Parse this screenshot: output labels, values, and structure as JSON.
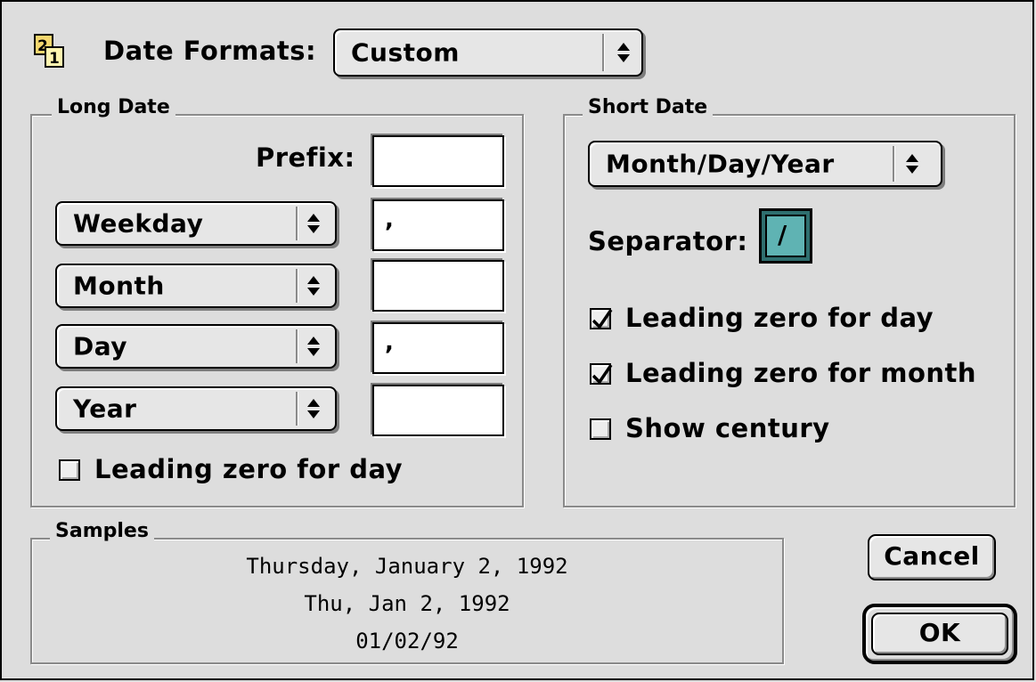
{
  "header": {
    "icon": "date-formats-icon",
    "label": "Date Formats:",
    "selected": "Custom"
  },
  "long_date": {
    "title": "Long Date",
    "prefix_label": "Prefix:",
    "prefix_value": "",
    "rows": [
      {
        "popup": "Weekday",
        "separator": ","
      },
      {
        "popup": "Month",
        "separator": ""
      },
      {
        "popup": "Day",
        "separator": ","
      },
      {
        "popup": "Year",
        "separator": ""
      }
    ],
    "leading_zero_label": "Leading zero for day",
    "leading_zero_checked": false
  },
  "short_date": {
    "title": "Short Date",
    "order": "Month/Day/Year",
    "separator_label": "Separator:",
    "separator_value": "/",
    "options": [
      {
        "label": "Leading zero for day",
        "checked": true
      },
      {
        "label": "Leading zero for month",
        "checked": true
      },
      {
        "label": "Show century",
        "checked": false
      }
    ]
  },
  "samples": {
    "title": "Samples",
    "lines": [
      "Thursday, January 2, 1992",
      "Thu, Jan 2, 1992",
      "01/02/92"
    ]
  },
  "buttons": {
    "cancel": "Cancel",
    "ok": "OK"
  },
  "colors": {
    "background": "#dddddd",
    "selection": "#5fb3b3"
  }
}
